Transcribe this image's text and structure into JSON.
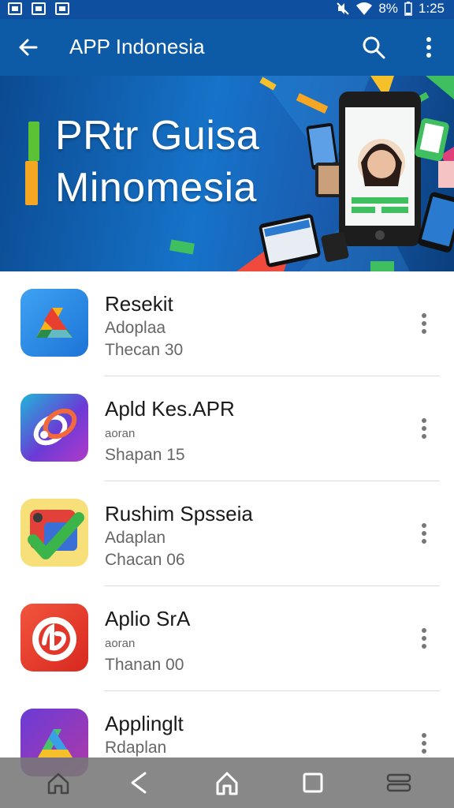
{
  "status": {
    "battery": "8%",
    "time": "1:25"
  },
  "appbar": {
    "title": "APP Indonesia"
  },
  "banner": {
    "line1": "PRtr Guisa",
    "line2": "Minomesia"
  },
  "apps": [
    {
      "name": "Resekit",
      "subtitle": "Adoplaa",
      "meta": "Thecan  30"
    },
    {
      "name": "Apld Kes.APR",
      "subtitle": "aoran",
      "meta": "Shapan  15"
    },
    {
      "name": "Rushim Spsseia",
      "subtitle": "Adaplan",
      "meta": "Chacan  06"
    },
    {
      "name": "Aplio SrA",
      "subtitle": "aoran",
      "meta": "Thanan  00"
    },
    {
      "name": "Applinglt",
      "subtitle": "Rdaplan",
      "meta": ""
    }
  ],
  "colors": {
    "statusbar": "#0e4fa0",
    "appbar": "#0d5aa7",
    "navbar": "#7a7a7a"
  }
}
